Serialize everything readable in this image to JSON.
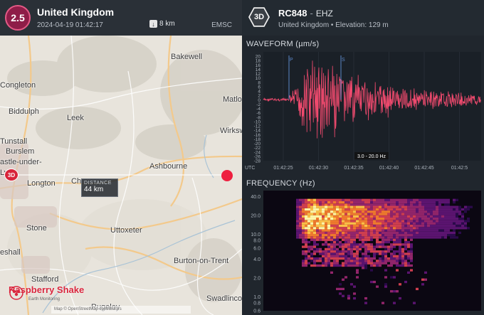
{
  "event": {
    "magnitude": "2.5",
    "region": "United Kingdom",
    "datetime": "2024-04-19 01:42:17",
    "depth": "8 km",
    "agency": "EMSC",
    "depth_icon": "arrow-down-icon"
  },
  "map": {
    "towns": [
      {
        "name": "Bakewell"
      },
      {
        "name": "Congleton"
      },
      {
        "name": "Matloc"
      },
      {
        "name": "Biddulph"
      },
      {
        "name": "Leek"
      },
      {
        "name": "Wirksworth"
      },
      {
        "name": "Tunstall"
      },
      {
        "name": "Burslem"
      },
      {
        "name": "astle-under-"
      },
      {
        "name": "Ly"
      },
      {
        "name": "Ashbourne"
      },
      {
        "name": "Longton"
      },
      {
        "name": "Ch"
      },
      {
        "name": "Stone"
      },
      {
        "name": "Uttoxeter"
      },
      {
        "name": "eshall"
      },
      {
        "name": "Stafford"
      },
      {
        "name": "Burton-on-Trent"
      },
      {
        "name": "Swadlinco"
      },
      {
        "name": "Rugeley"
      }
    ],
    "distance_label": "DISTANCE",
    "distance_value": "44 km",
    "station_marker_label": "3D",
    "brand_name": "Raspberry Shake",
    "brand_sub": "Earth Monitoring",
    "attribution": "Map © OpenStreetMap contributors"
  },
  "station": {
    "badge": "3D",
    "code": "RC848",
    "separator": "-",
    "channel": "EHZ",
    "subtitle": "United Kingdom • Elevation: 129 m"
  },
  "waveform": {
    "title": "WAVEFORM (µm/s)",
    "y_ticks": [
      "20",
      "18",
      "16",
      "14",
      "12",
      "10",
      "8",
      "6",
      "4",
      "2",
      "0",
      "-2",
      "-4",
      "-6",
      "-8",
      "-10",
      "-12",
      "-14",
      "-16",
      "-18",
      "-20",
      "-22",
      "-24",
      "-26",
      "-28"
    ],
    "x_ticks": [
      "01:42:25",
      "01:42:30",
      "01:42:35",
      "01:42:40",
      "01:42:45",
      "01:42:5"
    ],
    "x_unit": "UTC",
    "filter_label": "3.0 - 20.0 Hz",
    "ylim": [
      -28,
      22
    ],
    "phase_markers": [
      "P",
      "S"
    ],
    "line_color": "#f04a6e"
  },
  "spectrogram": {
    "title": "FREQUENCY (Hz)",
    "y_ticks": [
      "40.0",
      "20.0",
      "10.0",
      "8.0",
      "6.0",
      "4.0",
      "2.0",
      "1.0",
      "0.8",
      "0.6"
    ]
  }
}
